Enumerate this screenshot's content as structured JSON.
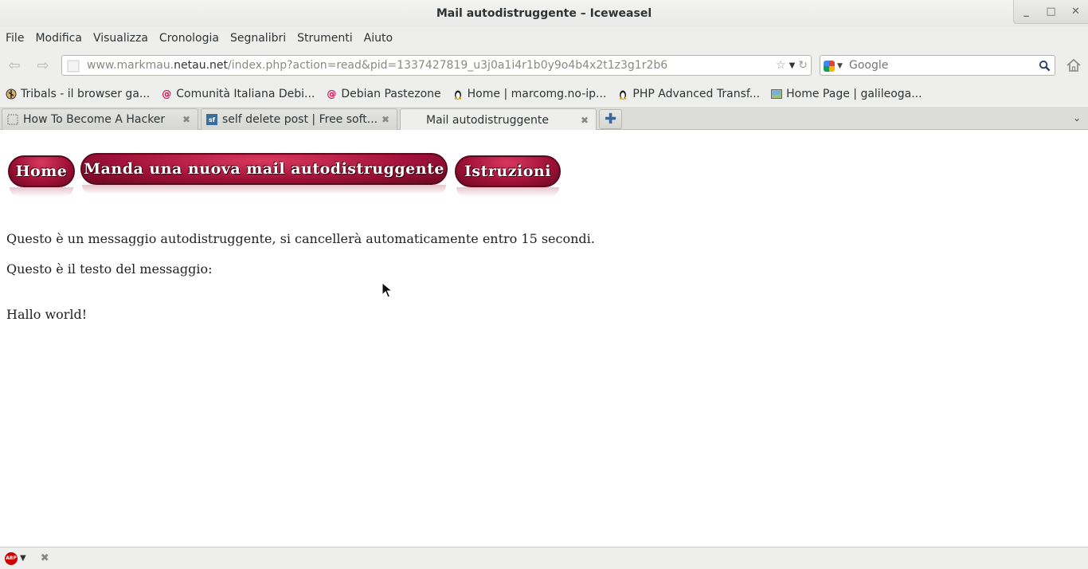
{
  "window": {
    "title": "Mail autodistruggente – Iceweasel",
    "controls": {
      "minimize": "_",
      "maximize": "□",
      "close": "✕"
    }
  },
  "menu": [
    "File",
    "Modifica",
    "Visualizza",
    "Cronologia",
    "Segnalibri",
    "Strumenti",
    "Aiuto"
  ],
  "navbar": {
    "url_prefix": "www.markmau.",
    "url_host": "netau.net",
    "url_path": "/index.php?action=read&pid=1337427819_u3j0a1i4r1b0y9o4b4x2t1z3g1r2b6",
    "search_placeholder": "Google"
  },
  "bookmarks": [
    {
      "label": "Tribals - il browser ga...",
      "icon": "tribals-icon"
    },
    {
      "label": "Comunità Italiana Debi...",
      "icon": "debian-swirl-icon"
    },
    {
      "label": "Debian Pastezone",
      "icon": "debian-swirl-icon"
    },
    {
      "label": "Home | marcomg.no-ip...",
      "icon": "tux-icon"
    },
    {
      "label": "PHP Advanced Transf...",
      "icon": "tux-icon"
    },
    {
      "label": "Home Page | galileoga...",
      "icon": "image-icon"
    }
  ],
  "tabs": [
    {
      "title": "How To Become A Hacker",
      "active": false
    },
    {
      "title": "self delete post | Free soft...",
      "active": false,
      "badge": "sf"
    },
    {
      "title": "Mail autodistruggente",
      "active": true
    }
  ],
  "page": {
    "nav_buttons": {
      "home": "Home",
      "new_mail": "Manda una nuova mail autodistruggente",
      "instructions": "Istruzioni"
    },
    "notice": "Questo è un messaggio autodistruggente, si cancellerà automaticamente entro 15 secondi.",
    "intro": "Questo è il testo del messaggio:",
    "message": "Hallo world!"
  },
  "statusbar": {
    "adblock_label": "ABP"
  },
  "colors": {
    "button_red": "#a3123a",
    "chrome_bg": "#eeeeec"
  }
}
